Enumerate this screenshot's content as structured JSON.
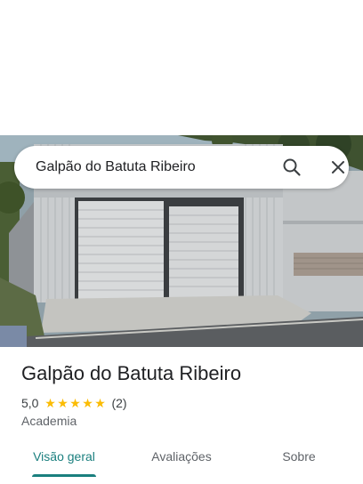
{
  "search": {
    "query": "Galpão do Batuta Ribeiro",
    "search_icon": "search-icon",
    "close_icon": "close-icon"
  },
  "hero": {
    "image": "warehouse-photo",
    "description_icon": "photo"
  },
  "place": {
    "name": "Galpão do Batuta Ribeiro",
    "rating": "5,0",
    "stars": 5,
    "review_count": "(2)",
    "category": "Academia"
  },
  "tabs": [
    {
      "label": "Visão geral",
      "active": true
    },
    {
      "label": "Avaliações",
      "active": false
    },
    {
      "label": "Sobre",
      "active": false
    }
  ],
  "colors": {
    "accent": "#1a7f7e",
    "star": "#fbbc04",
    "title_text": "#202124",
    "secondary_text": "#5f6368"
  }
}
